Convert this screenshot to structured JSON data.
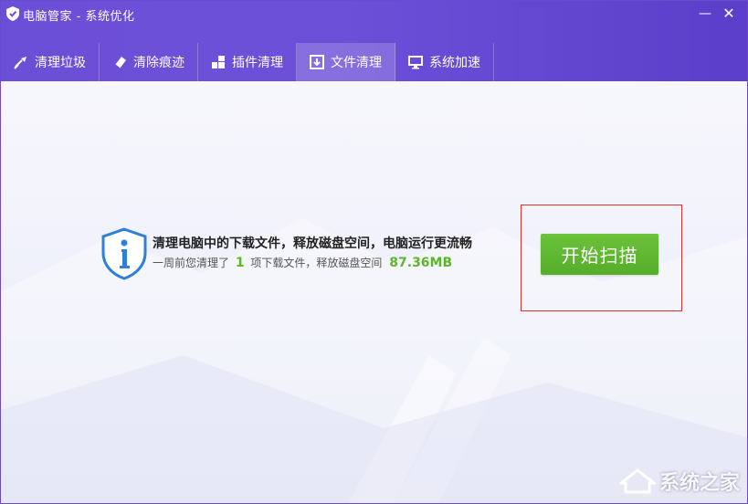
{
  "window": {
    "title": "电脑管家 - 系统优化",
    "min_symbol": "—",
    "close_symbol": "✕"
  },
  "tabs": [
    {
      "label": "清理垃圾",
      "icon": "broom-icon",
      "active": false
    },
    {
      "label": "清除痕迹",
      "icon": "eraser-icon",
      "active": false
    },
    {
      "label": "插件清理",
      "icon": "puzzle-icon",
      "active": false
    },
    {
      "label": "文件清理",
      "icon": "download-file-icon",
      "active": true
    },
    {
      "label": "系统加速",
      "icon": "monitor-icon",
      "active": false
    }
  ],
  "main": {
    "headline": "清理电脑中的下载文件，释放磁盘空间，电脑运行更流畅",
    "sub_prefix": "一周前您清理了",
    "sub_count": "1",
    "sub_middle": "项下载文件，释放磁盘空间",
    "sub_size": "87.36MB",
    "scan_button": "开始扫描"
  },
  "watermark": {
    "text": "系统之家"
  },
  "colors": {
    "header": "#6b4fd6",
    "accent_green": "#5fb52a",
    "highlight_red": "#e03030",
    "info_blue": "#2f7fd8"
  }
}
